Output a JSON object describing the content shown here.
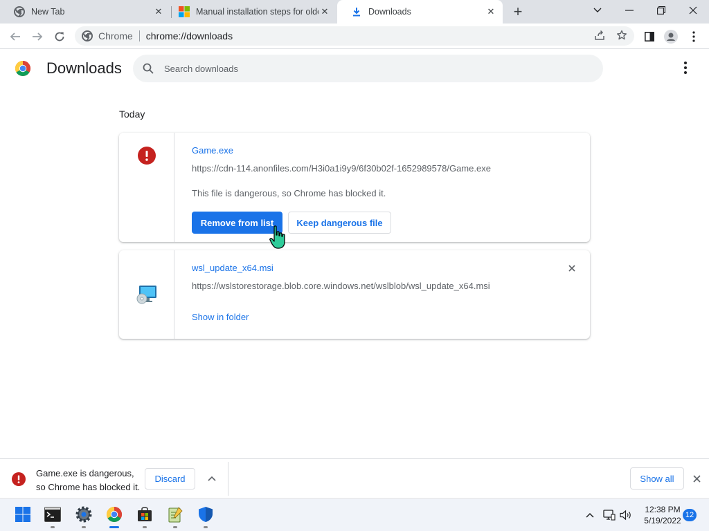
{
  "browser": {
    "tabs": [
      {
        "label": "New Tab",
        "icon": "chrome-icon"
      },
      {
        "label": "Manual installation steps for older versions of WSL",
        "icon": "microsoft-icon"
      },
      {
        "label": "Downloads",
        "icon": "download-icon"
      }
    ],
    "omnibox": {
      "site": "Chrome",
      "url": "chrome://downloads"
    }
  },
  "page": {
    "title": "Downloads",
    "search_placeholder": "Search downloads",
    "day_label": "Today"
  },
  "downloads": [
    {
      "filename": "Game.exe",
      "url": "https://cdn-114.anonfiles.com/H3i0a1i9y9/6f30b02f-1652989578/Game.exe",
      "status": "This file is dangerous, so Chrome has blocked it.",
      "primary_action": "Remove from list",
      "secondary_action": "Keep dangerous file"
    },
    {
      "filename": "wsl_update_x64.msi",
      "url": "https://wslstorestorage.blob.core.windows.net/wslblob/wsl_update_x64.msi",
      "link": "Show in folder"
    }
  ],
  "shelf": {
    "message_line1": "Game.exe is dangerous,",
    "message_line2": "so Chrome has blocked it.",
    "discard": "Discard",
    "show_all": "Show all"
  },
  "taskbar": {
    "time": "12:38 PM",
    "date": "5/19/2022",
    "notifications": "12"
  },
  "colors": {
    "accent": "#1a73e8",
    "danger": "#c5221f",
    "tabstrip": "#dee1e6"
  }
}
